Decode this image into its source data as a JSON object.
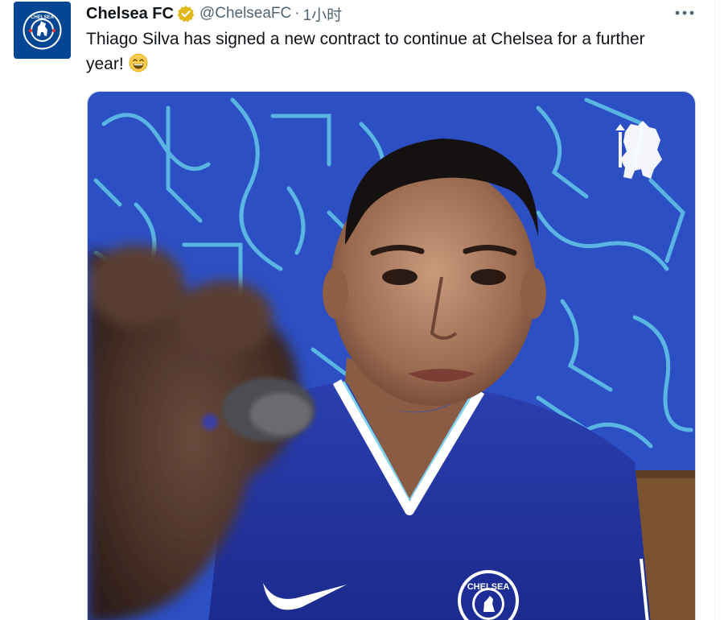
{
  "tweet": {
    "display_name": "Chelsea FC",
    "handle": "@ChelseaFC",
    "separator": "·",
    "timestamp": "1小时",
    "text": "Thiago Silva has signed a new contract to continue at Chelsea for a further year!",
    "emoji": "grinning-face-with-smiling-eyes"
  },
  "icons": {
    "verified": "gold-verified-badge-icon",
    "more": "more-options-icon",
    "avatar": "chelsea-crest-avatar"
  },
  "media": {
    "crest_text": "CHELSEA",
    "description_kind": "photo"
  },
  "colors": {
    "chelsea_blue": "#034694",
    "verified_gold": "#e2b719",
    "text_primary": "#0f1419",
    "text_secondary": "#536471",
    "mural_blue": "#2c4fc4",
    "mural_line": "#5fc1e6"
  }
}
